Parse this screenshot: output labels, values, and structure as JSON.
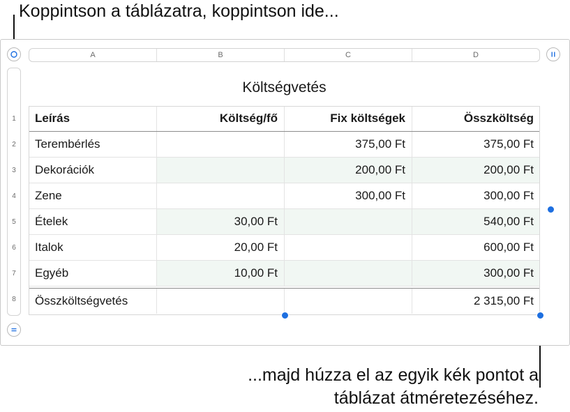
{
  "callouts": {
    "top": "Koppintson a táblázatra, koppintson ide...",
    "bottom_line1": "...majd húzza el az egyik kék pontot a",
    "bottom_line2": "táblázat átméretezéséhez."
  },
  "column_headers": [
    "A",
    "B",
    "C",
    "D"
  ],
  "row_numbers": [
    "1",
    "2",
    "3",
    "4",
    "5",
    "6",
    "7",
    "8"
  ],
  "table": {
    "title": "Költségvetés",
    "header": [
      "Leírás",
      "Költség/fő",
      "Fix költségek",
      "Összköltség"
    ],
    "rows": [
      [
        "Terembérlés",
        "",
        "375,00 Ft",
        "375,00 Ft"
      ],
      [
        "Dekorációk",
        "",
        "200,00 Ft",
        "200,00 Ft"
      ],
      [
        "Zene",
        "",
        "300,00 Ft",
        "300,00 Ft"
      ],
      [
        "Ételek",
        "30,00 Ft",
        "",
        "540,00 Ft"
      ],
      [
        "Italok",
        "20,00 Ft",
        "",
        "600,00 Ft"
      ],
      [
        "Egyéb",
        "10,00 Ft",
        "",
        "300,00 Ft"
      ]
    ],
    "footer": [
      "Összköltségvetés",
      "",
      "",
      "2 315,00 Ft"
    ]
  },
  "icons": {
    "select_table": "circle-icon",
    "add_column": "pause-bars-icon",
    "add_row": "equals-icon",
    "resize_handle": "blue-dot"
  },
  "colors": {
    "accent": "#1e6fe0",
    "alt_row": "#f1f7f3",
    "border": "#d3d3d3"
  }
}
